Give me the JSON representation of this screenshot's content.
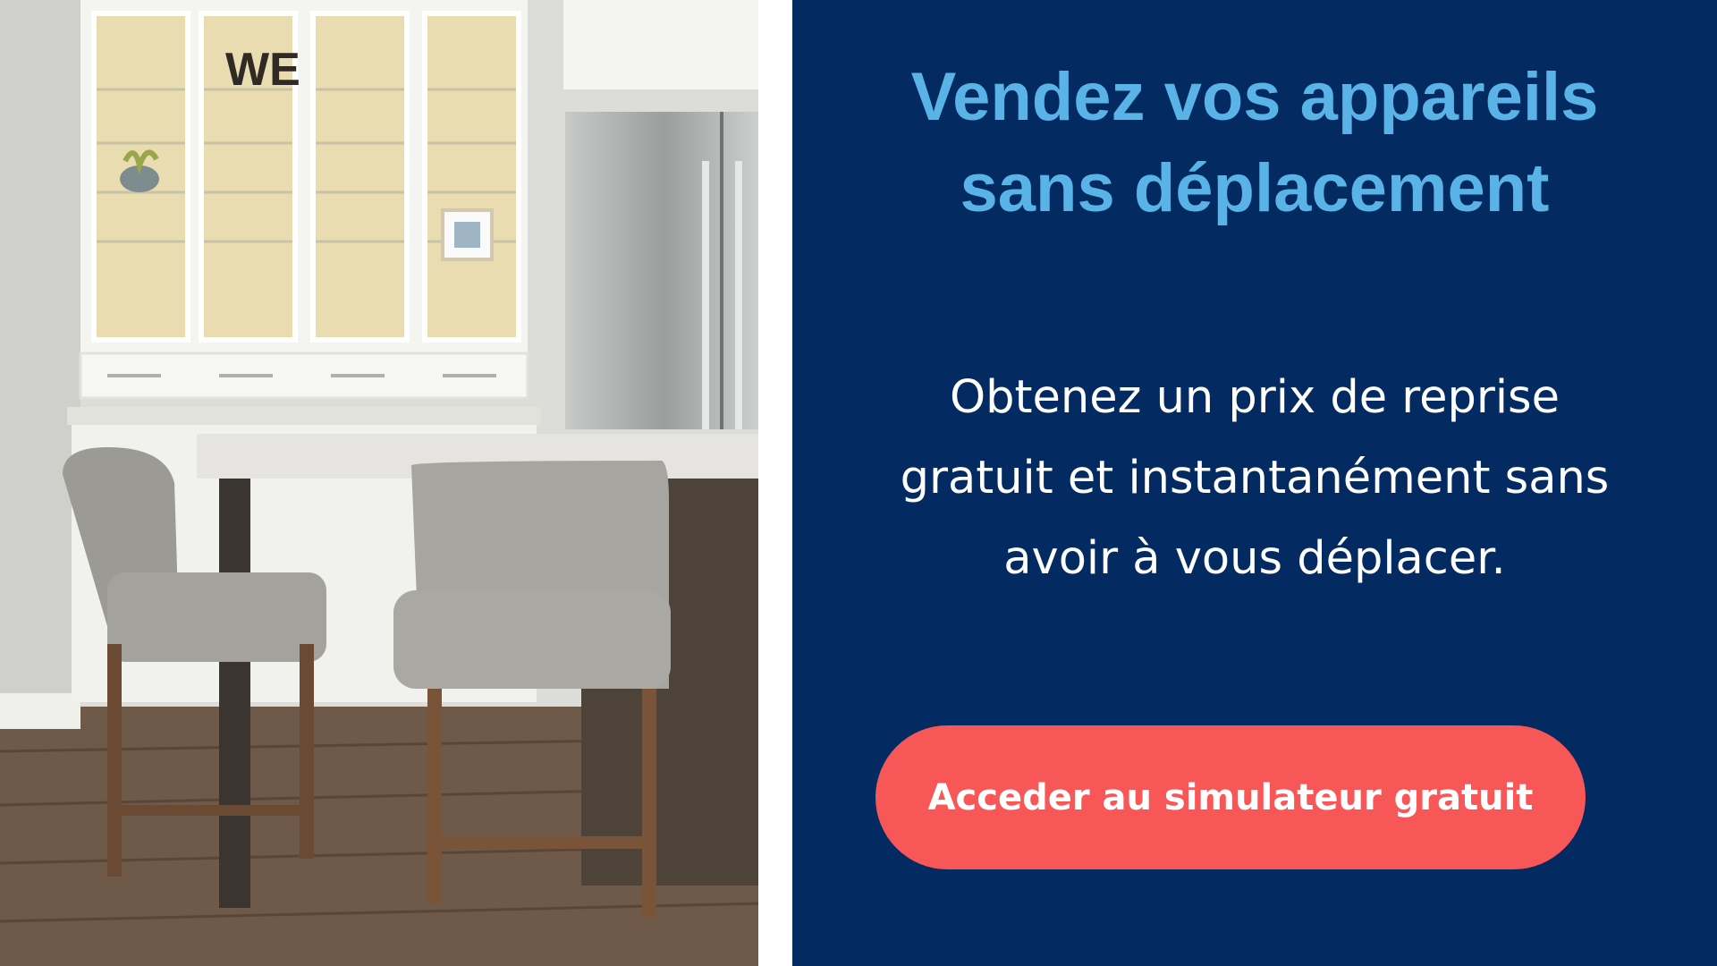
{
  "hero_image": {
    "alt": "Kitchen with white glass-front cabinets, stainless steel refrigerator, marble-top island and upholstered bar stools",
    "sign_text": "WE"
  },
  "headline": {
    "line1": "Vendez vos appareils",
    "line2": "sans déplacement"
  },
  "body": {
    "line1": "Obtenez un prix de reprise",
    "line2": "gratuit et instantanément sans",
    "line3": "avoir à vous déplacer."
  },
  "cta": {
    "label": "Acceder au simulateur gratuit"
  },
  "colors": {
    "panel_background": "#032b61",
    "headline": "#5ab3e6",
    "body_text": "#ffffff",
    "cta_background": "#f75757",
    "cta_text": "#ffffff"
  }
}
